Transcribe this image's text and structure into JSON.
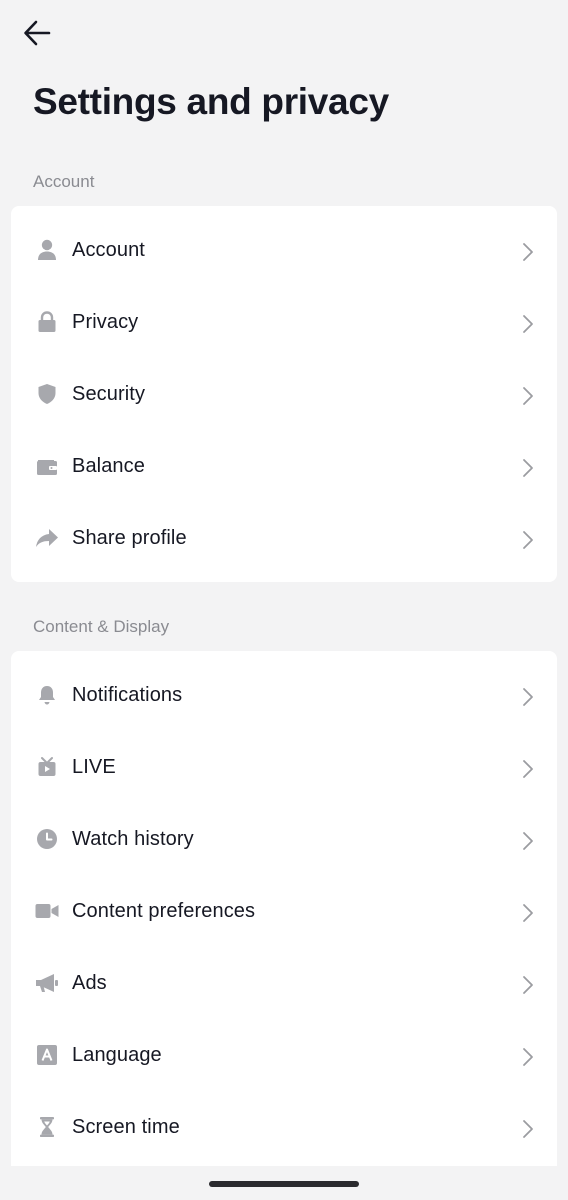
{
  "header": {
    "title": "Settings and privacy",
    "back_icon": "arrow-left-icon"
  },
  "sections": [
    {
      "label": "Account",
      "items": [
        {
          "label": "Account",
          "icon": "person-icon"
        },
        {
          "label": "Privacy",
          "icon": "lock-icon"
        },
        {
          "label": "Security",
          "icon": "shield-icon"
        },
        {
          "label": "Balance",
          "icon": "wallet-icon"
        },
        {
          "label": "Share profile",
          "icon": "share-arrow-icon"
        }
      ]
    },
    {
      "label": "Content & Display",
      "items": [
        {
          "label": "Notifications",
          "icon": "bell-icon"
        },
        {
          "label": "LIVE",
          "icon": "live-tv-icon"
        },
        {
          "label": "Watch history",
          "icon": "clock-icon"
        },
        {
          "label": "Content preferences",
          "icon": "video-camera-icon"
        },
        {
          "label": "Ads",
          "icon": "megaphone-icon"
        },
        {
          "label": "Language",
          "icon": "language-a-icon"
        },
        {
          "label": "Screen time",
          "icon": "hourglass-icon"
        }
      ]
    }
  ],
  "colors": {
    "background": "#f3f3f4",
    "card": "#ffffff",
    "text": "#161823",
    "section_label": "#8a8b91",
    "icon": "#a7a8ad",
    "chevron": "#9b9ca1"
  }
}
